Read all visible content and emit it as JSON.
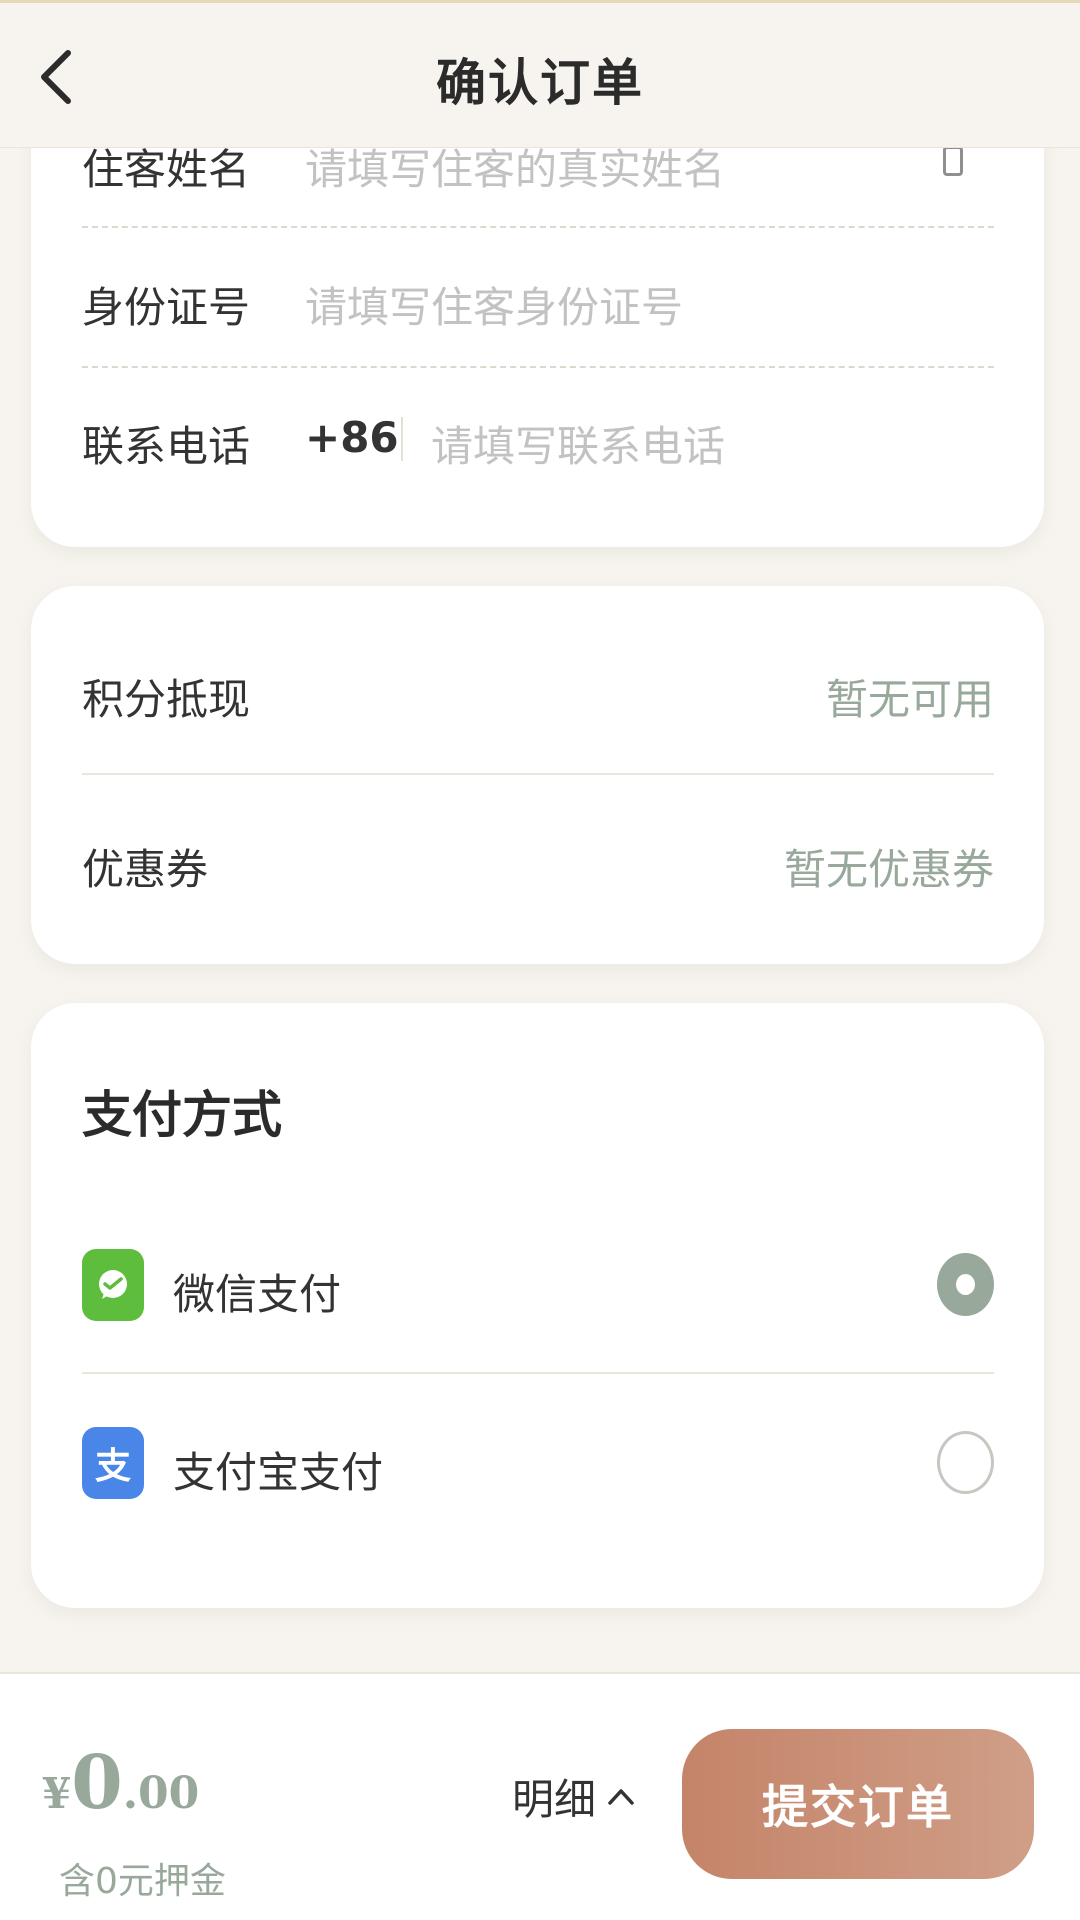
{
  "header": {
    "title": "确认订单"
  },
  "guest_form": {
    "name_label": "住客姓名",
    "name_placeholder": "请填写住客的真实姓名",
    "id_label": "身份证号",
    "id_placeholder": "请填写住客身份证号",
    "phone_label": "联系电话",
    "country_code": "+86",
    "phone_placeholder": "请填写联系电话"
  },
  "discounts": {
    "points_label": "积分抵现",
    "points_value": "暂无可用",
    "coupon_label": "优惠券",
    "coupon_value": "暂无优惠券"
  },
  "payment": {
    "title": "支付方式",
    "methods": [
      {
        "label": "微信支付",
        "icon": "wechat-pay-icon",
        "selected": true,
        "color": "#5ebd3c"
      },
      {
        "label": "支付宝支付",
        "icon": "alipay-icon",
        "icon_text": "支",
        "selected": false,
        "color": "#4a86e8"
      }
    ]
  },
  "footer": {
    "currency": "¥",
    "price_int": "0",
    "price_dec": ".00",
    "deposit_note": "含0元押金",
    "detail_label": "明细",
    "submit_label": "提交订单"
  },
  "colors": {
    "accent_green": "#98a89b",
    "submit_gradient_start": "#c48469",
    "submit_gradient_end": "#d09e87"
  }
}
